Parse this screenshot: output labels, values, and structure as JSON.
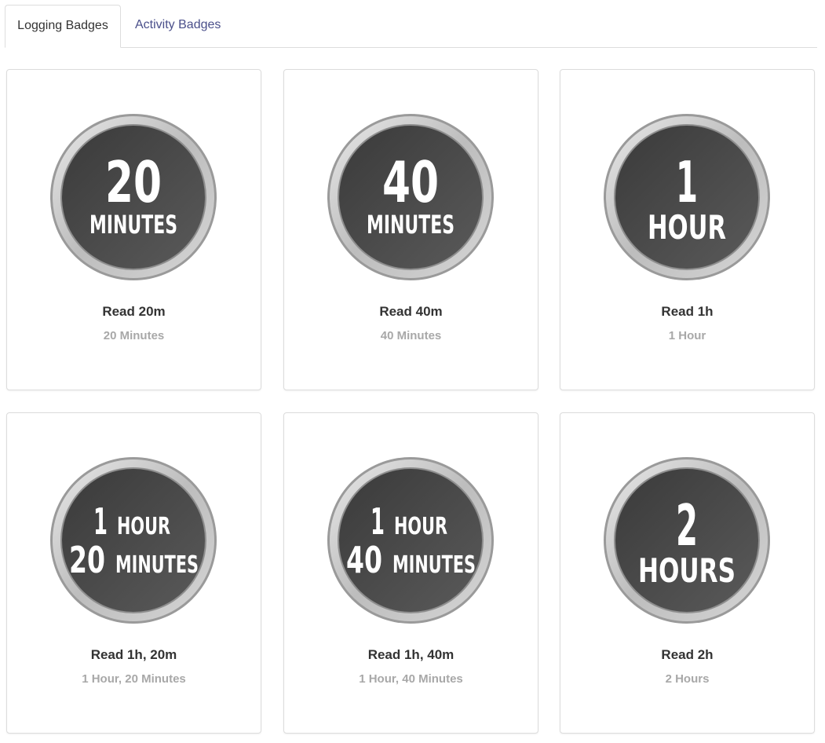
{
  "tabs": [
    {
      "label": "Logging Badges",
      "active": true
    },
    {
      "label": "Activity Badges",
      "active": false
    }
  ],
  "colors": {
    "badge_face": "#4a4a4a",
    "badge_ring": "#c9c9c9",
    "title": "#333333",
    "subtitle": "#a8a8a8",
    "tab_link": "#4a4f8a"
  },
  "badges": [
    {
      "lines": [
        [
          "20"
        ],
        [
          "MINUTES"
        ]
      ],
      "title": "Read 20m",
      "subtitle": "20 Minutes"
    },
    {
      "lines": [
        [
          "40"
        ],
        [
          "MINUTES"
        ]
      ],
      "title": "Read 40m",
      "subtitle": "40 Minutes"
    },
    {
      "lines": [
        [
          "1"
        ],
        [
          "HOUR"
        ]
      ],
      "title": "Read 1h",
      "subtitle": "1 Hour"
    },
    {
      "lines": [
        [
          "1",
          "HOUR"
        ],
        [
          "20",
          "MINUTES"
        ]
      ],
      "title": "Read 1h, 20m",
      "subtitle": "1 Hour, 20 Minutes"
    },
    {
      "lines": [
        [
          "1",
          "HOUR"
        ],
        [
          "40",
          "MINUTES"
        ]
      ],
      "title": "Read 1h, 40m",
      "subtitle": "1 Hour, 40 Minutes"
    },
    {
      "lines": [
        [
          "2"
        ],
        [
          "HOURS"
        ]
      ],
      "title": "Read 2h",
      "subtitle": "2 Hours"
    }
  ]
}
